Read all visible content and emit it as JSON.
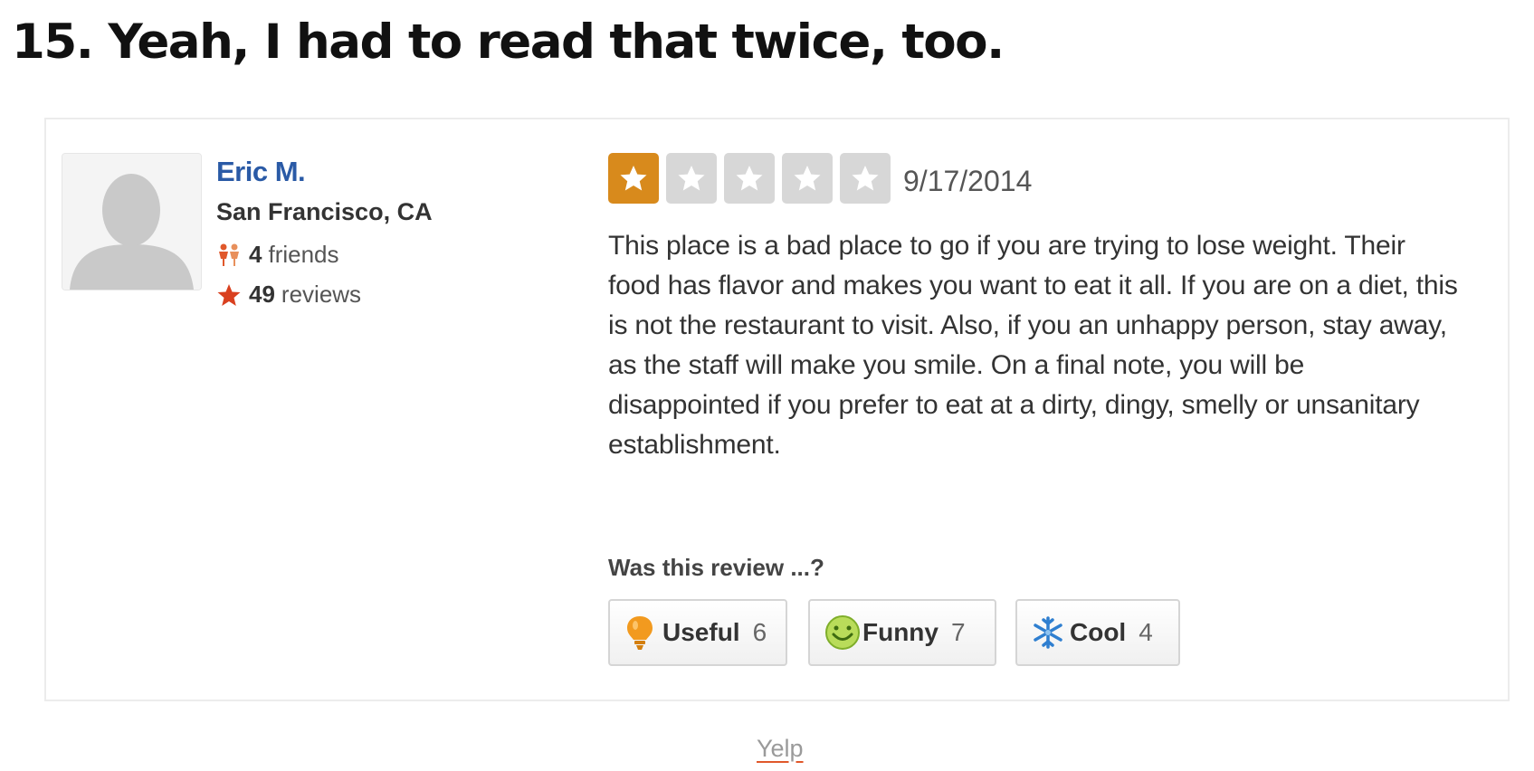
{
  "heading": "15. Yeah, I had to read that twice, too.",
  "review": {
    "user": {
      "name": "Eric M.",
      "location": "San Francisco, CA",
      "friends_count": "4",
      "friends_label": "friends",
      "reviews_count": "49",
      "reviews_label": "reviews"
    },
    "rating": {
      "value": 1,
      "max": 5
    },
    "date": "9/17/2014",
    "text": "This place is a bad place to go if you are trying to lose weight. Their food has flavor and makes you want to eat it all. If you are on a diet, this is not the restaurant to visit. Also, if you an unhappy person, stay away, as the staff will make you smile. On a final note, you will be disappointed if you prefer to eat at a dirty, dingy, smelly or unsanitary establishment.",
    "votes_prompt": "Was this review ...?",
    "votes": [
      {
        "label": "Useful",
        "count": "6",
        "icon": "lightbulb-icon"
      },
      {
        "label": "Funny",
        "count": "7",
        "icon": "smiley-icon"
      },
      {
        "label": "Cool",
        "count": "4",
        "icon": "snowflake-icon"
      }
    ]
  },
  "source": "Yelp",
  "colors": {
    "name_link": "#2a5aa6",
    "star_active": "#d88a1c",
    "star_inactive": "#d7d7d7",
    "accent_red": "#e0582b"
  }
}
